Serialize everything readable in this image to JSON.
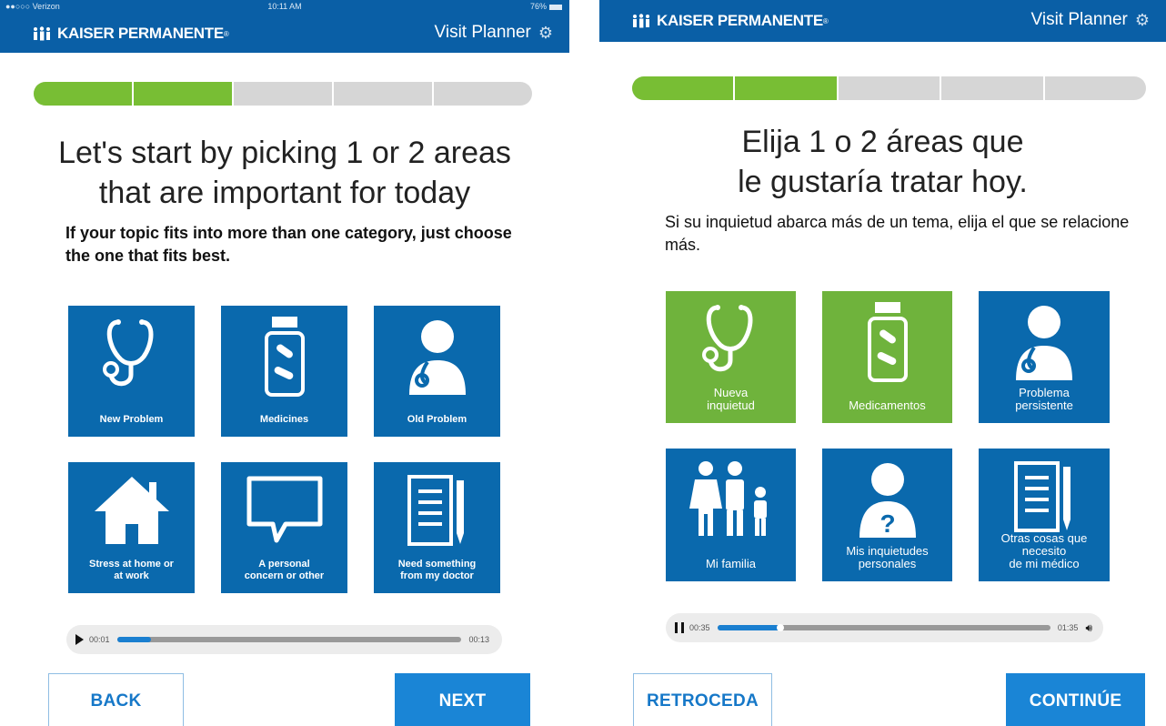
{
  "colors": {
    "brand_blue": "#0a5fa6",
    "tile_blue": "#0a69ad",
    "progress_green": "#78be34",
    "button_blue": "#1a85d6"
  },
  "english": {
    "status_bar": {
      "carrier": "●●○○○ Verizon",
      "time": "10:11 AM",
      "battery": "76%"
    },
    "header": {
      "logo_text": "KAISER PERMANENTE",
      "logo_reg": "®",
      "planner_label": "Visit Planner",
      "settings_icon": "gear-icon"
    },
    "progress": {
      "segments_total": 5,
      "segments_completed": 2
    },
    "heading_line1": "Let's start by picking 1 or 2 areas",
    "heading_line2": "that are important for today",
    "subtext": "If your topic fits into more than one category, just choose the one that fits best.",
    "tiles": [
      {
        "label": "New Problem",
        "icon": "stethoscope-icon",
        "selected": false
      },
      {
        "label": "Medicines",
        "icon": "pill-bottle-icon",
        "selected": false
      },
      {
        "label": "Old Problem",
        "icon": "doctor-icon",
        "selected": false
      },
      {
        "label": "Stress at home or\nat work",
        "icon": "house-icon",
        "selected": false
      },
      {
        "label": "A personal\nconcern or other",
        "icon": "speech-bubble-icon",
        "selected": false
      },
      {
        "label": "Need something\nfrom my doctor",
        "icon": "notepad-icon",
        "selected": false
      }
    ],
    "audio": {
      "state": "paused",
      "current": "00:01",
      "total": "00:13",
      "progress": 0.1
    },
    "buttons": {
      "back": "BACK",
      "next": "NEXT"
    }
  },
  "spanish": {
    "header": {
      "logo_text": "KAISER PERMANENTE",
      "logo_reg": "®",
      "planner_label": "Visit Planner",
      "settings_icon": "gear-icon"
    },
    "progress": {
      "segments_total": 5,
      "segments_completed": 2
    },
    "heading_line1": "Elija 1 o 2 áreas que",
    "heading_line2": "le gustaría tratar hoy.",
    "subtext": "Si su inquietud abarca más de un tema, elija el que se relacione más.",
    "tiles": [
      {
        "label": "Nueva\ninquietud",
        "icon": "stethoscope-icon",
        "selected": true
      },
      {
        "label": "Medicamentos",
        "icon": "pill-bottle-icon",
        "selected": true
      },
      {
        "label": "Problema\npersistente",
        "icon": "doctor-icon",
        "selected": false
      },
      {
        "label": "Mi familia",
        "icon": "family-icon",
        "selected": false
      },
      {
        "label": "Mis inquietudes\npersonales",
        "icon": "person-question-icon",
        "selected": false
      },
      {
        "label": "Otras cosas que\nnecesito\nde mi médico",
        "icon": "notepad-icon",
        "selected": false
      }
    ],
    "audio": {
      "state": "playing",
      "current": "00:35",
      "total": "01:35",
      "progress": 0.19
    },
    "buttons": {
      "back": "RETROCEDA",
      "next": "CONTINÚE"
    }
  }
}
